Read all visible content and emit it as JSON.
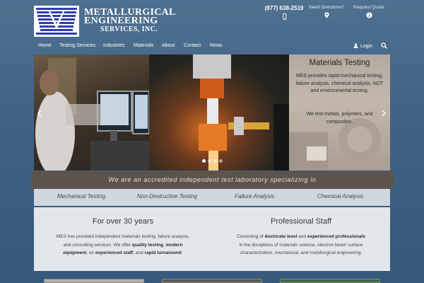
{
  "brand": {
    "line1": "METALLURGICAL",
    "line2": "ENGINEERING",
    "line3": "SERVICES, INC."
  },
  "utility": {
    "phone": "(877) 638-2519",
    "directions": "Need Directions?",
    "quote": "Request Quote",
    "phone_icon": "phone-icon",
    "directions_icon": "map-pin-icon",
    "quote_icon": "info-icon"
  },
  "nav": {
    "items": [
      "Home",
      "Testing Services",
      "Industries",
      "Materials",
      "About",
      "Contact",
      "News"
    ],
    "login": "Login",
    "login_icon": "user-icon",
    "search_icon": "search-icon"
  },
  "slider": {
    "title": "Materials Testing",
    "text1": "MES provides rapid mechanical testing, failure analysis, chemical analysis, NDT and environmental testing.",
    "text2": "We test metals, polymers, and composites.",
    "slide_count": 4,
    "active_slide": 1
  },
  "banner": {
    "text": "We are an accredited independent test laboratory specializing in"
  },
  "services": [
    "Mechanical Testing",
    "Non-Destructive Testing",
    "Failure Analysis",
    "Chemical Analysis"
  ],
  "left_col": {
    "title": "For over 30 years",
    "p1": "MES has provided independent materials testing, failure analysis,",
    "p2a": "and consulting services. We offer ",
    "b1": "quality testing",
    "p2b": ", ",
    "b2": "modern",
    "b3": "equipment",
    "p3a": ", an ",
    "b4": "experienced staff",
    "p3b": ", and ",
    "b5": "rapid turnaround",
    "p3c": "."
  },
  "right_col": {
    "title": "Professional Staff",
    "p1a": "Consisting of ",
    "b1": "doctorate level",
    "p1b": " and ",
    "b2": "experienced professionals",
    "p2": "in the disciplines of materials science, electron beam surface",
    "p3": "characterization, mechanical, and metallurgical engineering."
  },
  "colors": {
    "background": "#3f6283",
    "banner": "#5b534c",
    "services_bar": "#cfd6dd",
    "content": "#e4e7ea"
  }
}
